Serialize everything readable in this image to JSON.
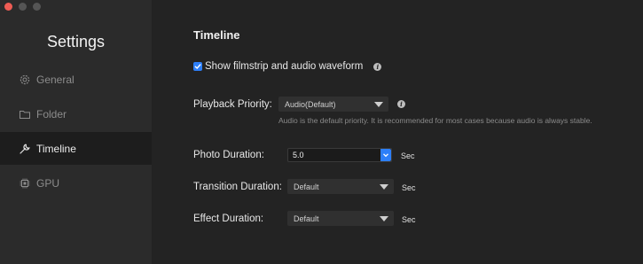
{
  "sidebar": {
    "title": "Settings",
    "items": [
      {
        "label": "General",
        "icon": "gear-icon"
      },
      {
        "label": "Folder",
        "icon": "folder-icon"
      },
      {
        "label": "Timeline",
        "icon": "wrench-icon",
        "active": true
      },
      {
        "label": "GPU",
        "icon": "chip-icon"
      }
    ]
  },
  "main": {
    "title": "Timeline",
    "filmstrip": {
      "label": "Show filmstrip and audio waveform",
      "checked": true
    },
    "playback": {
      "label": "Playback Priority:",
      "value": "Audio(Default)",
      "hint": "Audio is the default priority. It is recommended for most cases because audio is always stable."
    },
    "photo": {
      "label": "Photo Duration:",
      "value": "5.0",
      "unit": "Sec"
    },
    "transition": {
      "label": "Transition Duration:",
      "value": "Default",
      "unit": "Sec"
    },
    "effect": {
      "label": "Effect Duration:",
      "value": "Default",
      "unit": "Sec"
    }
  },
  "colors": {
    "accent": "#2d7ff9",
    "close": "#ee5c54",
    "background": "#232323",
    "sidebar": "#2b2b2b"
  }
}
